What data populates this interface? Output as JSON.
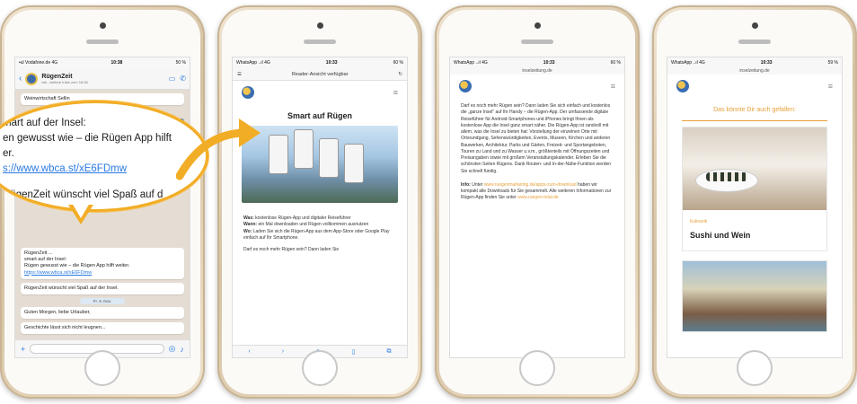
{
  "phone1": {
    "status_left": "•ul Vodafone.de 4G",
    "status_time": "10:38",
    "status_right": "50 %",
    "chat_title": "RügenZeit",
    "chat_sub": "tab., weitere Infos zum 18:38",
    "msg1": "Weinwirtschaft Sellin",
    "date1": "Do. 8. Nov.",
    "msg2_head": "RügenZeit ...",
    "msg2_line1": "smart auf der Insel:",
    "msg2_line2": "Rügen gewusst wie – die Rügen App hilft weiter.",
    "msg2_link": "https://www.wbca.st/xE6FDmw",
    "msg3": "RügenZeit wünscht viel Spaß auf der Insel.",
    "date2": "Fr. 9. Nov.",
    "msg4": "Guten Morgen, liebe Urlauber,",
    "msg5": "Geschichte lässt sich nicht leugnen..."
  },
  "callout": {
    "line1": "mart auf der Insel:",
    "line2": "en gewusst wie – die Rügen App hilft",
    "line3": "er.",
    "line4": "s://www.wbca.st/xE6FDmw",
    "line5": "RügenZeit wünscht viel Spaß auf d"
  },
  "phone2": {
    "status_left": "WhatsApp ..ıl 4G",
    "status_time": "10:33",
    "status_right": "60 %",
    "reader_label": "Reader-Ansicht verfügbar",
    "title": "Smart auf Rügen",
    "p1_label": "Was:",
    "p1": "kostenlose Rügen-App und digitaler Reiseführer",
    "p2_label": "Wann:",
    "p2": "ein Mal downloaden und Rügen vollkommen ausnutzen",
    "p3_label": "Wo:",
    "p3": "Laden Sie sich die Rügen-App aus dem App-Store oder Google Play einfach auf Ihr Smartphone.",
    "p4": "Darf es noch mehr Rügen sein? Dann laden Sie"
  },
  "phone3": {
    "status_left": "WhatsApp ..ıl 4G",
    "status_time": "10:33",
    "status_right": "60 %",
    "url": "inselzeitung.de",
    "body": "Darf es noch mehr Rügen sein? Dann laden Sie sich einfach und kostenlos die „ganze Insel\" auf Ihr Handy – die Rügen-App. Der umfassende digitale Reiseführer für Android-Smartphones und iPhones bringt Ihnen als kostenlose App die Insel ganz smart näher. Die Rügen-App ist randvoll mit allem, was die Insel zu bieten hat: Vorstellung der einzelnen Orte mit Ortsrundgang, Sehenswürdigkeiten, Events, Museen, Kirchen und anderen Bauwerken, Architektur, Parks und Gärten, Freizeit- und Sportangeboten, Touren zu Land und zu Wasser u.v.m., größtenteils mit Öffnungszeiten und Preisangaben sowie mit großem Veranstaltungskalender. Erleben Sie die schönsten Seiten Rügens. Dank Routen- und In-der-Nähe-Funktion werden Sie schnell fündig.",
    "info_label": "Info:",
    "info1": "Unter",
    "info_link1": "www.ruegenmarketing.de/apps-zum-download",
    "info2": "haben wir kompakt alle Downloads für Sie gesammelt. Alle weiteren Informationen zur Rügen-App finden Sie unter",
    "info_link2": "www.ruegen-total.de"
  },
  "phone4": {
    "status_left": "WhatsApp ..ıl 4G",
    "status_time": "10:33",
    "status_right": "59 %",
    "url": "inselzeitung.de",
    "suggest": "Das könnte Dir auch gefallen:",
    "card_category": "Kulinarik",
    "card_title": "Sushi und Wein"
  },
  "colors": {
    "accent": "#f2ad26",
    "link": "#2a7ae2",
    "orange_text": "#e8a03a"
  }
}
